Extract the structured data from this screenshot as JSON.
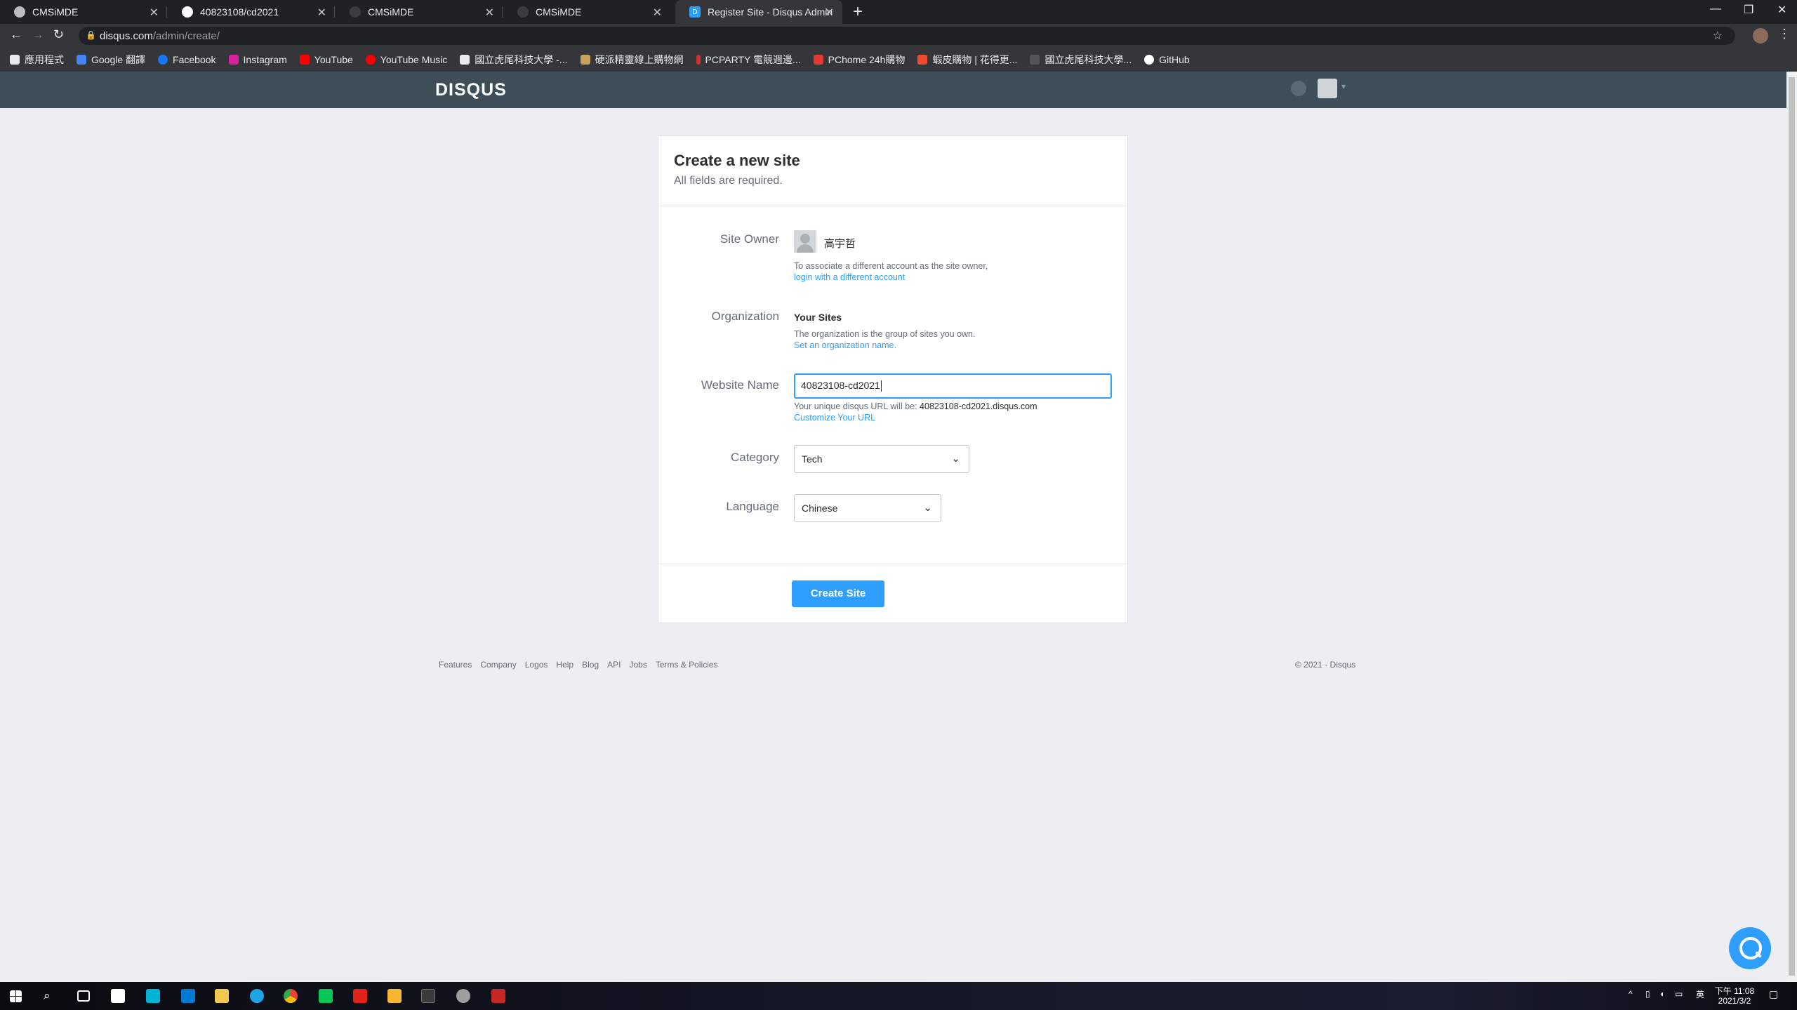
{
  "browser": {
    "tabs": [
      {
        "title": "CMSiMDE",
        "fav_color": "#bdbdbd"
      },
      {
        "title": "40823108/cd2021",
        "fav_color": "#ffffff"
      },
      {
        "title": "CMSiMDE",
        "fav_color": "#3c3c3c"
      },
      {
        "title": "CMSiMDE",
        "fav_color": "#3c3c3c"
      },
      {
        "title": "Register Site - Disqus Admin",
        "fav_color": "#2e9fff"
      }
    ],
    "new_tab": "+",
    "url_host": "disqus.com",
    "url_path": "/admin/create/",
    "bookmarks": [
      {
        "label": "應用程式",
        "color": "#e8eaed"
      },
      {
        "label": "Google 翻譯",
        "color": "#4285f4"
      },
      {
        "label": "Facebook",
        "color": "#1877f2"
      },
      {
        "label": "Instagram",
        "color": "#d6249f"
      },
      {
        "label": "YouTube",
        "color": "#ff0000"
      },
      {
        "label": "YouTube Music",
        "color": "#ff0000"
      },
      {
        "label": "國立虎尾科技大學 -...",
        "color": "#e8eaed"
      },
      {
        "label": "硬派精靈線上購物網",
        "color": "#c8a15a"
      },
      {
        "label": "PCPARTY 電競週邊...",
        "color": "#d32f2f"
      },
      {
        "label": "PChome 24h購物",
        "color": "#e53935"
      },
      {
        "label": "蝦皮購物 | 花得更...",
        "color": "#ee4d2d"
      },
      {
        "label": "國立虎尾科技大學...",
        "color": "#555555"
      },
      {
        "label": "GitHub",
        "color": "#ffffff"
      }
    ]
  },
  "disqus": {
    "logo": "DISQUS",
    "card": {
      "title": "Create a new site",
      "subtitle": "All fields are required.",
      "site_owner": {
        "label": "Site Owner",
        "name": "高宇哲",
        "help": "To associate a different account as the site owner,",
        "link": "login with a different account"
      },
      "organization": {
        "label": "Organization",
        "value": "Your Sites",
        "help": "The organization is the group of sites you own.",
        "link": "Set an organization name."
      },
      "website_name": {
        "label": "Website Name",
        "value": "40823108-cd2021",
        "help_prefix": "Your unique disqus URL will be: ",
        "help_url": "40823108-cd2021.disqus.com",
        "link": "Customize Your URL"
      },
      "category": {
        "label": "Category",
        "value": "Tech"
      },
      "language": {
        "label": "Language",
        "value": "Chinese"
      },
      "submit": "Create Site"
    },
    "footer_links": [
      "Features",
      "Company",
      "Logos",
      "Help",
      "Blog",
      "API",
      "Jobs",
      "Terms & Policies"
    ],
    "copyright": "© 2021 · Disqus"
  },
  "taskbar": {
    "time": "下午 11:08",
    "date": "2021/3/2",
    "ime": "英",
    "apps": [
      {
        "name": "start",
        "color": "#ffffff"
      },
      {
        "name": "search",
        "color": "#ffffff"
      },
      {
        "name": "task-view",
        "color": "#ffffff"
      },
      {
        "name": "store",
        "color": "#ffffff"
      },
      {
        "name": "arduino",
        "color": "#00b4d8"
      },
      {
        "name": "mail",
        "color": "#0078d4"
      },
      {
        "name": "explorer",
        "color": "#f2c94c"
      },
      {
        "name": "edge",
        "color": "#1fa5e5"
      },
      {
        "name": "chrome",
        "color": "#fbbc05"
      },
      {
        "name": "line",
        "color": "#06c755"
      },
      {
        "name": "acrobat",
        "color": "#e2231a"
      },
      {
        "name": "illustrator",
        "color": "#f7b731"
      },
      {
        "name": "terminal",
        "color": "#3a3a3a"
      },
      {
        "name": "obs",
        "color": "#9e9e9e"
      },
      {
        "name": "bandicam",
        "color": "#c62828"
      }
    ]
  }
}
